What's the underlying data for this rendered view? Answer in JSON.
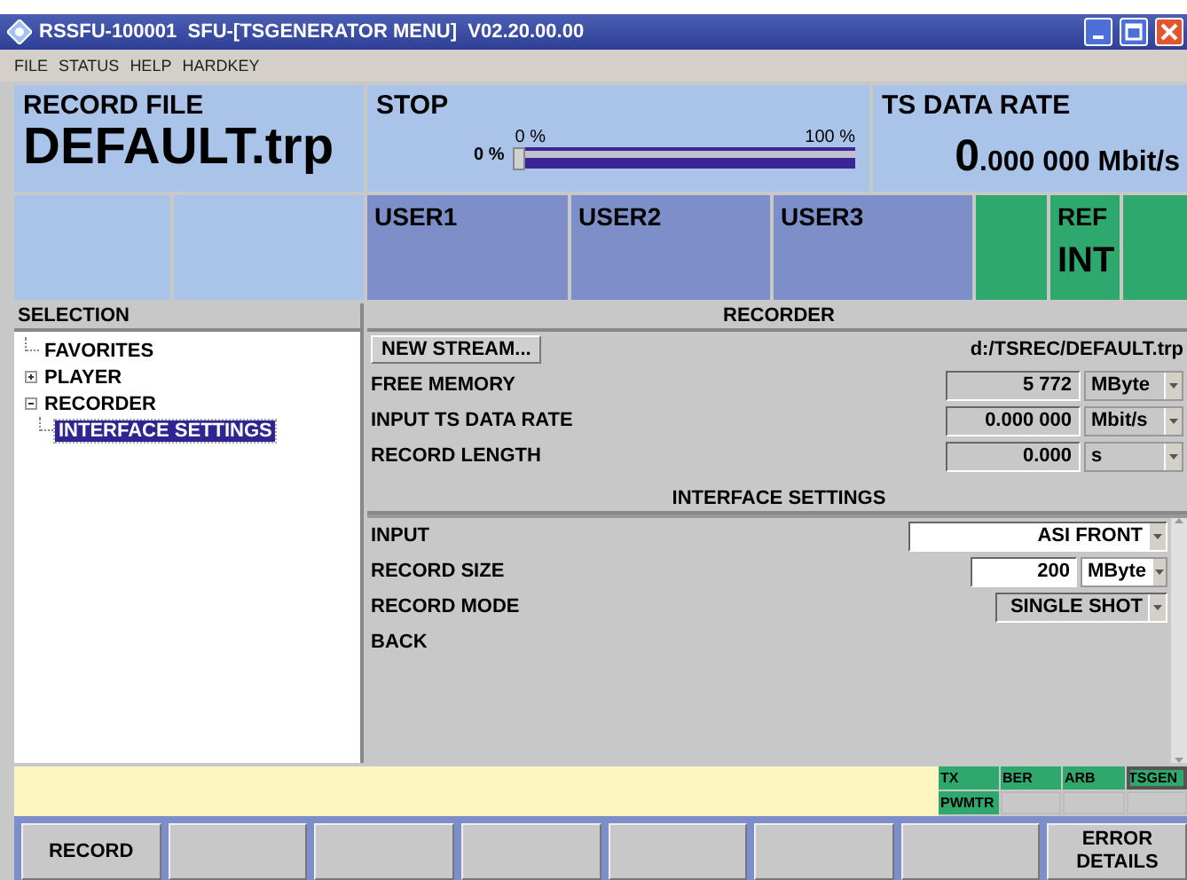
{
  "window": {
    "title": "RSSFU-100001  SFU-[TSGENERATOR MENU]  V02.20.00.00"
  },
  "menu": [
    "FILE",
    "STATUS",
    "HELP",
    "HARDKEY"
  ],
  "record_file": {
    "label": "RECORD FILE",
    "value": "DEFAULT.trp"
  },
  "progress": {
    "label": "STOP",
    "reading": "0 %",
    "min_label": "0 %",
    "max_label": "100 %",
    "level": 0
  },
  "ts_data_rate": {
    "label": "TS DATA RATE",
    "value_major": "0",
    "value_minor": ".000 000 Mbit/s"
  },
  "tiles": [
    {
      "kind": "blank"
    },
    {
      "kind": "blank"
    },
    {
      "kind": "user",
      "label": "USER1"
    },
    {
      "kind": "user",
      "label": "USER2"
    },
    {
      "kind": "user",
      "label": "USER3"
    },
    {
      "kind": "status"
    },
    {
      "kind": "status",
      "label": "REF",
      "value": "INT"
    },
    {
      "kind": "status"
    }
  ],
  "selection": {
    "title": "SELECTION",
    "tree": [
      {
        "label": "FAVORITES",
        "selected": false
      },
      {
        "label": "PLAYER",
        "expanded": false,
        "selected": false
      },
      {
        "label": "RECORDER",
        "expanded": true,
        "selected": false,
        "children": [
          {
            "label": "INTERFACE SETTINGS",
            "selected": true
          }
        ]
      }
    ]
  },
  "recorder": {
    "title": "RECORDER",
    "button": "NEW STREAM...",
    "path": "d:/TSREC/DEFAULT.trp",
    "rows": [
      {
        "label": "FREE MEMORY",
        "value": "5 772",
        "unit": "MByte"
      },
      {
        "label": "INPUT TS DATA RATE",
        "value": "0.000 000",
        "unit": "Mbit/s"
      },
      {
        "label": "RECORD LENGTH",
        "value": "0.000",
        "unit": "s"
      }
    ]
  },
  "interface_settings": {
    "title": "INTERFACE SETTINGS",
    "rows": [
      {
        "kind": "select",
        "label": "INPUT",
        "value": "ASI FRONT",
        "disabled": false
      },
      {
        "kind": "number",
        "label": "RECORD SIZE",
        "value": "200",
        "unit": "MByte"
      },
      {
        "kind": "select",
        "label": "RECORD MODE",
        "value": "SINGLE SHOT",
        "disabled": true
      },
      {
        "kind": "link",
        "label": "BACK"
      }
    ]
  },
  "status_tags": [
    {
      "label": "TX",
      "on": true,
      "selected": false
    },
    {
      "label": "BER",
      "on": true,
      "selected": false
    },
    {
      "label": "ARB",
      "on": true,
      "selected": false
    },
    {
      "label": "TSGEN",
      "on": true,
      "selected": true
    },
    {
      "label": "PWMTR",
      "on": true,
      "selected": false
    },
    {
      "on": false,
      "selected": false
    },
    {
      "on": false,
      "selected": false
    },
    {
      "on": false,
      "selected": false
    }
  ],
  "softkeys": [
    {
      "kind": "key",
      "label": "RECORD"
    },
    {
      "kind": "blank"
    },
    {
      "kind": "blank"
    },
    {
      "kind": "blank"
    },
    {
      "kind": "blank"
    },
    {
      "kind": "blank"
    },
    {
      "kind": "blank"
    },
    {
      "kind": "key",
      "label": "ERROR DETAILS"
    }
  ]
}
